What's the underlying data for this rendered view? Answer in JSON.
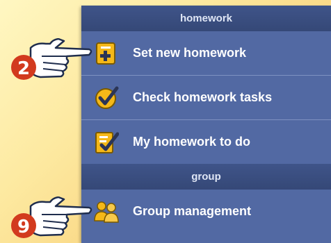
{
  "sections": [
    {
      "header": "homework",
      "items": [
        {
          "label": "Set new homework",
          "icon": "add-document-icon"
        },
        {
          "label": "Check homework tasks",
          "icon": "checkmark-icon"
        },
        {
          "label": "My homework to do",
          "icon": "checklist-icon"
        }
      ]
    },
    {
      "header": "group",
      "items": [
        {
          "label": "Group management",
          "icon": "users-icon"
        }
      ]
    }
  ],
  "callouts": [
    {
      "number": "2"
    },
    {
      "number": "9"
    }
  ],
  "colors": {
    "menu_bg": "#5269a3",
    "header_bg": "#3f5489",
    "badge_red": "#d23a1e",
    "icon_gold": "#f3b515"
  }
}
